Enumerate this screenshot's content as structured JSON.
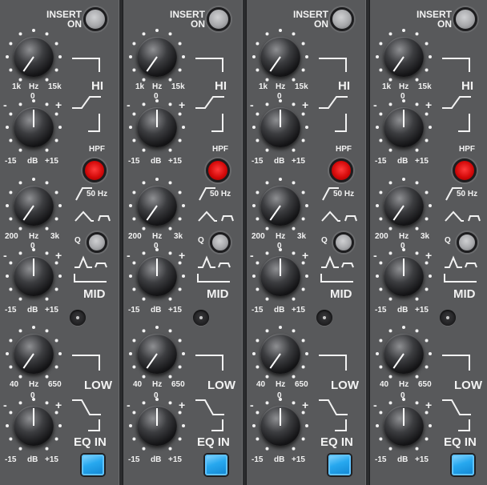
{
  "labels": {
    "insert": "INSERT",
    "on": "ON",
    "hi": "HI",
    "hpf": "HPF",
    "hpf_freq": "50 Hz",
    "q": "Q",
    "mid": "MID",
    "low": "LOW",
    "eq_in": "EQ IN",
    "hz": "Hz",
    "db": "dB",
    "plus": "+",
    "minus": "-",
    "zero": "0",
    "hi_freq_min": "1k",
    "hi_freq_max": "15k",
    "mid_freq_min": "200",
    "mid_freq_max": "3k",
    "low_freq_min": "40",
    "low_freq_max": "650",
    "gain_min": "-15",
    "gain_max": "+15"
  },
  "colors": {
    "panel": "#58595b",
    "hpf_button": "#d40a0a",
    "eq_in_button": "#27a8ef",
    "insert_button": "#a7a8ab"
  },
  "channel_count": 4
}
